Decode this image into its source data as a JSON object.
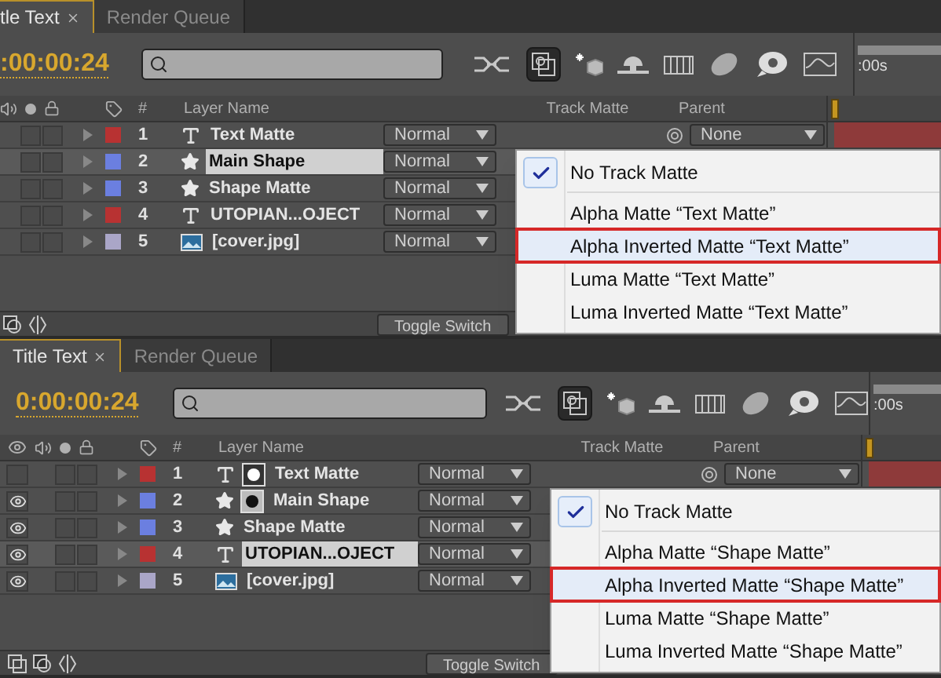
{
  "panels": [
    {
      "tabs": [
        {
          "label": "tle Text",
          "selected": true,
          "closable": true
        },
        {
          "label": "Render Queue",
          "selected": false,
          "closable": false
        }
      ],
      "timecode": ":00:00:24",
      "ruler_label": ":00s",
      "columns": {
        "number": "#",
        "layer_name": "Layer Name",
        "track_matte": "Track Matte",
        "parent": "Parent"
      },
      "layers": [
        {
          "number": "1",
          "name": "Text Matte",
          "kind": "text",
          "color": "#b83232",
          "selected": false,
          "mode": "Normal",
          "parent": "None"
        },
        {
          "number": "2",
          "name": "Main Shape",
          "kind": "shape",
          "color": "#6b7fe0",
          "selected": true,
          "mode": "Normal"
        },
        {
          "number": "3",
          "name": "Shape Matte",
          "kind": "shape",
          "color": "#6b7fe0",
          "selected": false,
          "mode": "Normal"
        },
        {
          "number": "4",
          "name": "UTOPIAN...OJECT",
          "kind": "text",
          "color": "#b83232",
          "selected": false,
          "mode": "Normal"
        },
        {
          "number": "5",
          "name": "[cover.jpg]",
          "kind": "image",
          "color": "#aaa6c8",
          "selected": false,
          "mode": "Normal"
        }
      ],
      "toggle_button": "Toggle Switch",
      "menu": [
        [
          {
            "label": "No Track Matte",
            "checked": true,
            "selected": false
          }
        ],
        [
          {
            "label": "Alpha Matte “Text Matte”",
            "checked": false,
            "selected": false
          },
          {
            "label": "Alpha Inverted Matte “Text Matte”",
            "checked": false,
            "selected": true
          },
          {
            "label": "Luma Matte “Text Matte”",
            "checked": false,
            "selected": false
          },
          {
            "label": "Luma Inverted Matte “Text Matte”",
            "checked": false,
            "selected": false
          }
        ]
      ]
    },
    {
      "tabs": [
        {
          "label": "Title Text",
          "selected": true,
          "closable": true
        },
        {
          "label": "Render Queue",
          "selected": false,
          "closable": false
        }
      ],
      "timecode": "0:00:00:24",
      "ruler_label": ":00s",
      "columns": {
        "number": "#",
        "layer_name": "Layer Name",
        "track_matte": "Track Matte",
        "parent": "Parent"
      },
      "layers": [
        {
          "number": "1",
          "name": "Text Matte",
          "kind": "text",
          "color": "#b83232",
          "selected": false,
          "visible": false,
          "thumbnail": {
            "kind": "light"
          },
          "mode": "Normal",
          "parent": "None"
        },
        {
          "number": "2",
          "name": "Main Shape",
          "kind": "shape",
          "color": "#6b7fe0",
          "selected": false,
          "visible": true,
          "thumbnail": {
            "kind": "dark"
          },
          "mode": "Normal"
        },
        {
          "number": "3",
          "name": "Shape Matte",
          "kind": "shape",
          "color": "#6b7fe0",
          "selected": false,
          "visible": true,
          "mode": "Normal"
        },
        {
          "number": "4",
          "name": "UTOPIAN...OJECT",
          "kind": "text",
          "color": "#b83232",
          "selected": true,
          "visible": true,
          "mode": "Normal"
        },
        {
          "number": "5",
          "name": "[cover.jpg]",
          "kind": "image",
          "color": "#aaa6c8",
          "selected": false,
          "visible": true,
          "mode": "Normal"
        }
      ],
      "toggle_button": "Toggle Switch",
      "menu": [
        [
          {
            "label": "No Track Matte",
            "checked": true,
            "selected": false
          }
        ],
        [
          {
            "label": "Alpha Matte “Shape Matte”",
            "checked": false,
            "selected": false
          },
          {
            "label": "Alpha Inverted Matte “Shape Matte”",
            "checked": false,
            "selected": true
          },
          {
            "label": "Luma Matte “Shape Matte”",
            "checked": false,
            "selected": false
          },
          {
            "label": "Luma Inverted Matte “Shape Matte”",
            "checked": false,
            "selected": false
          }
        ]
      ]
    }
  ]
}
